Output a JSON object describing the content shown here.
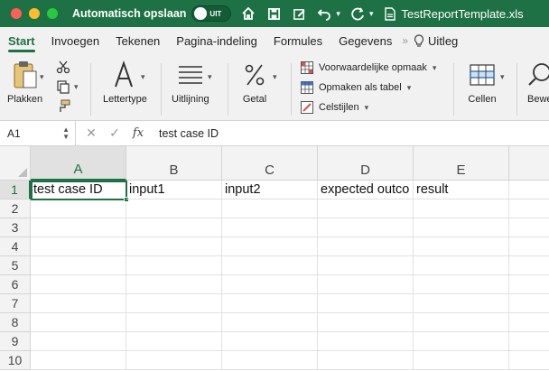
{
  "titlebar": {
    "autosave_label": "Automatisch opslaan",
    "toggle_state": "UIT",
    "file_name": "TestReportTemplate.xls"
  },
  "tabs": [
    "Start",
    "Invoegen",
    "Tekenen",
    "Pagina-indeling",
    "Formules",
    "Gegevens"
  ],
  "tabs_more": "»",
  "tell_me": "Uitleg",
  "ribbon": {
    "paste_label": "Plakken",
    "font_label": "Lettertype",
    "align_label": "Uitlijning",
    "number_label": "Getal",
    "styles": [
      "Voorwaardelijke opmaak",
      "Opmaken als tabel",
      "Celstijlen"
    ],
    "cells_label": "Cellen",
    "edit_label": "Bewe"
  },
  "formula_bar": {
    "name_box": "A1",
    "fx": "fx",
    "content": "test case ID"
  },
  "sheet": {
    "columns": [
      "A",
      "B",
      "C",
      "D",
      "E"
    ],
    "rows": [
      "1",
      "2",
      "3",
      "4",
      "5",
      "6",
      "7",
      "8",
      "9",
      "10"
    ],
    "row1": [
      "test case ID",
      "input1",
      "input2",
      "expected outco",
      "result"
    ]
  },
  "colors": {
    "accent": "#1e7145",
    "ribbon_bg": "#f1f1f1",
    "header_bg": "#f3f3f3"
  }
}
